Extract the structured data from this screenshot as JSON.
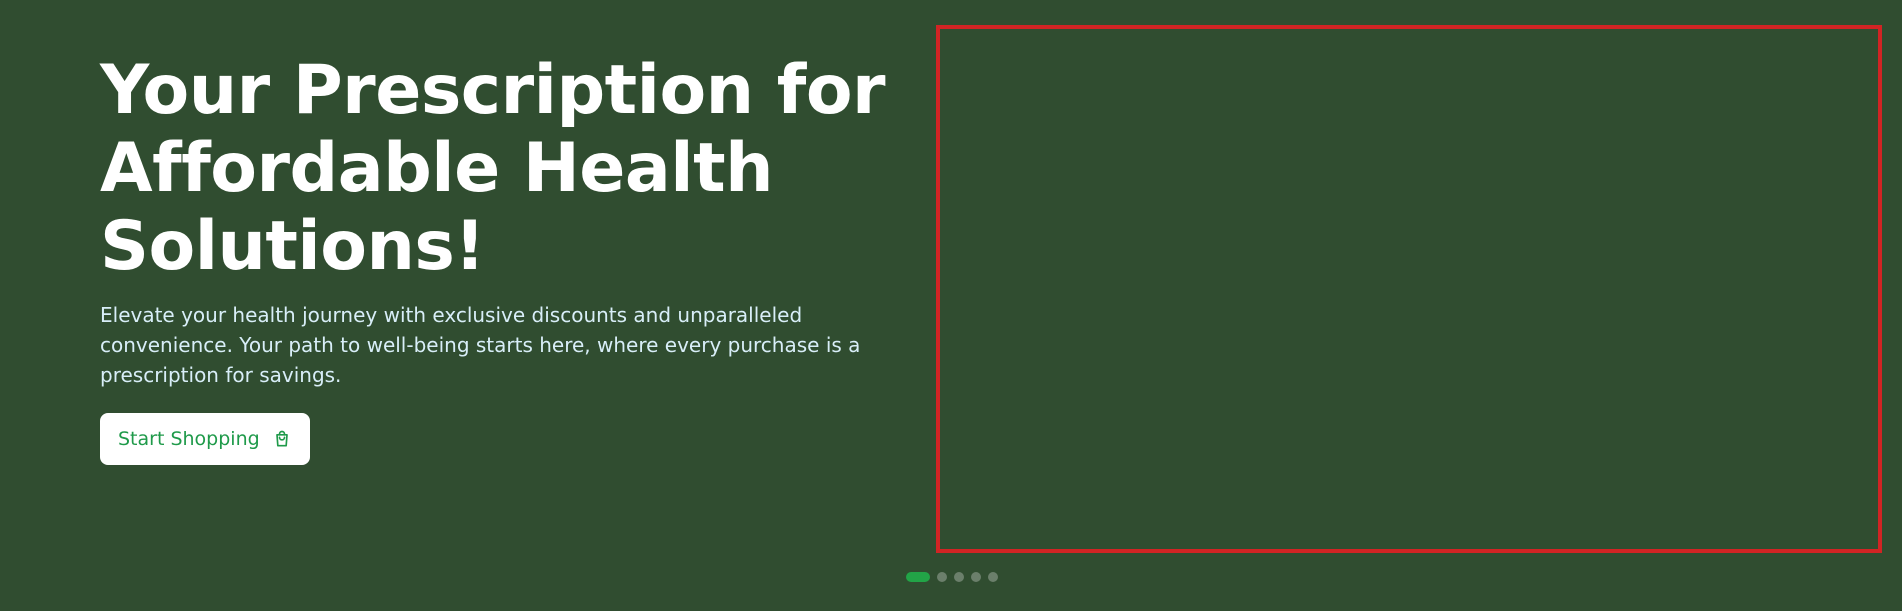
{
  "hero": {
    "title": "Your Prescription for Affordable Health Solutions!",
    "description": "Elevate your health journey with exclusive discounts and unparalleled convenience. Your path to well-being starts here, where every purchase is a prescription for savings.",
    "cta_label": "Start Shopping",
    "cta_icon": "shopping-bag-icon"
  },
  "carousel": {
    "slide_count": 5,
    "active_index": 0
  },
  "colors": {
    "background": "#304d30",
    "frame_border": "#d12424",
    "cta_text": "#1f9a4a",
    "active_dot": "#22a447",
    "inactive_dot": "#6b7f6b"
  }
}
